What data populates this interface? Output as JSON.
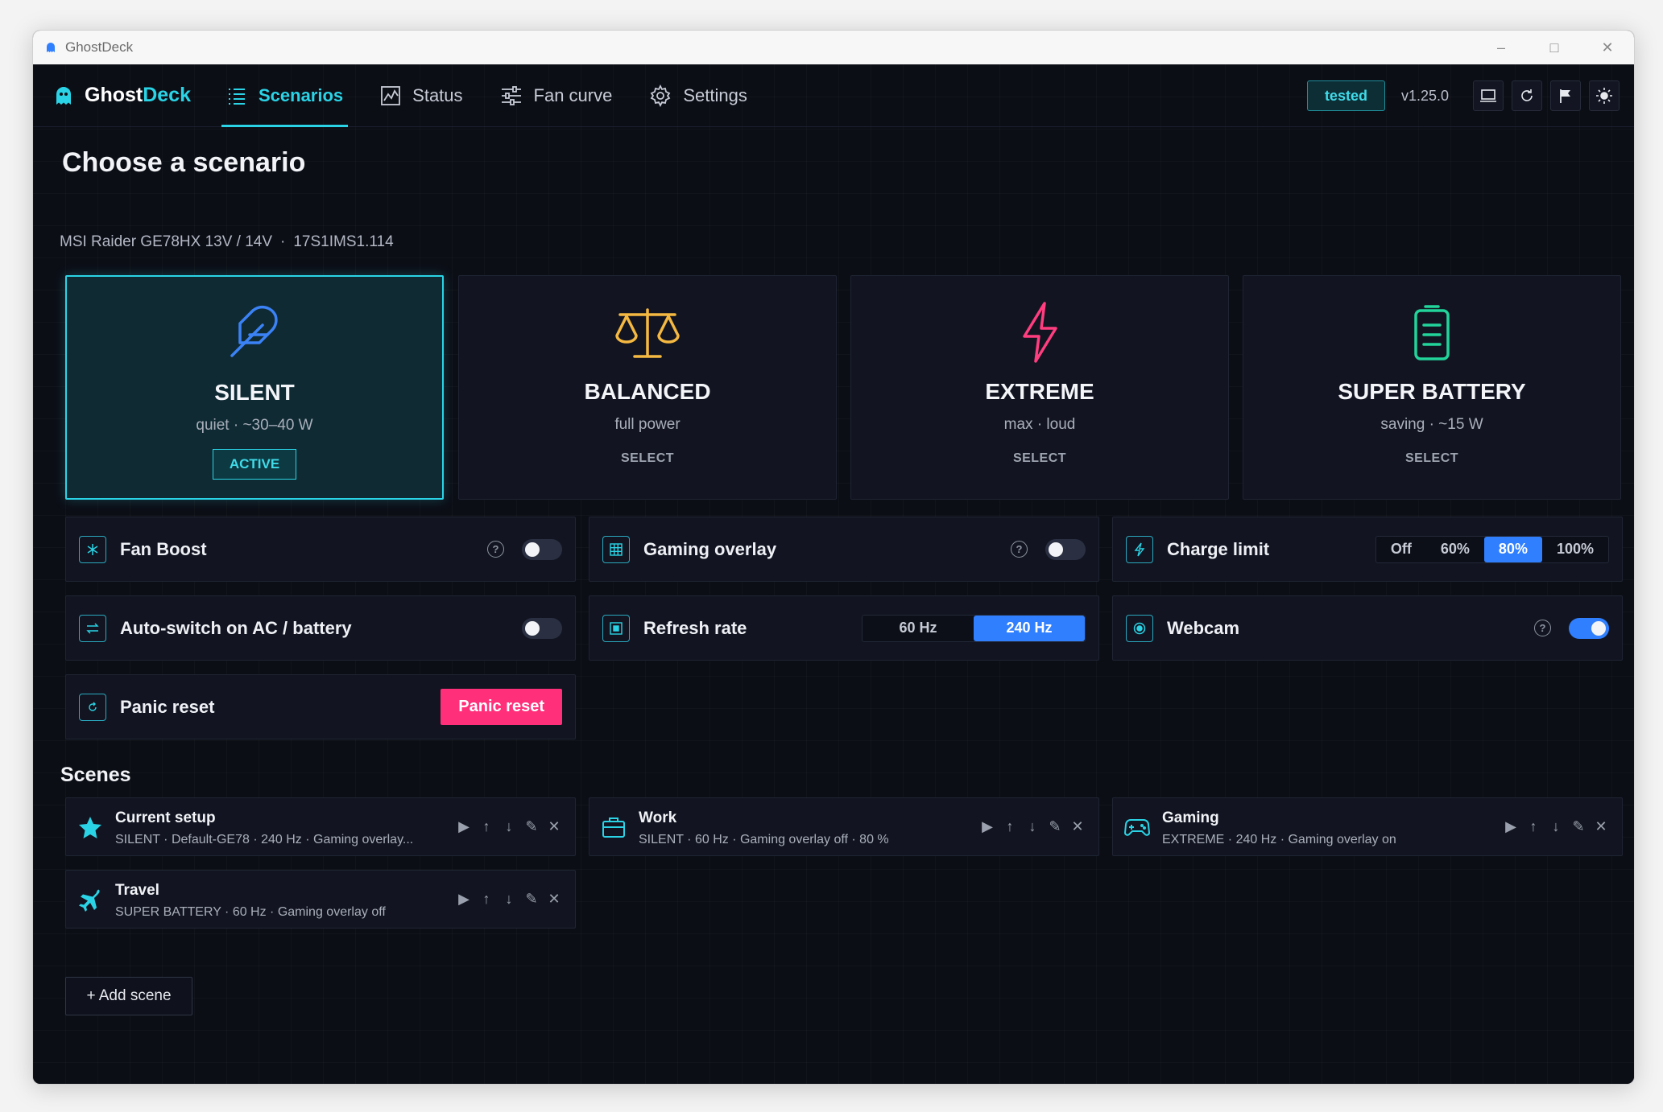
{
  "window": {
    "title": "GhostDeck",
    "controls": [
      "–",
      "□",
      "✕"
    ]
  },
  "brand": {
    "part1": "Ghost",
    "part2": "Deck"
  },
  "nav": {
    "tabs": [
      {
        "label": "Scenarios",
        "icon": "list-icon",
        "active": true
      },
      {
        "label": "Status",
        "icon": "chart-icon",
        "active": false
      },
      {
        "label": "Fan curve",
        "icon": "sliders-icon",
        "active": false
      },
      {
        "label": "Settings",
        "icon": "gear-icon",
        "active": false
      }
    ],
    "badge": "tested",
    "version": "v1.25.0",
    "icons": [
      "laptop-icon",
      "refresh-icon",
      "flag-icon",
      "sun-icon"
    ]
  },
  "page": {
    "title": "Choose a scenario",
    "device": "MSI Raider GE78HX 13V / 14V",
    "bios": "17S1IMS1.114",
    "separator": "·"
  },
  "scenarios": [
    {
      "name": "SILENT",
      "desc": "quiet · ~30–40 W",
      "action": "ACTIVE",
      "active": true,
      "icon": "feather-icon",
      "color": "#3b82f6"
    },
    {
      "name": "BALANCED",
      "desc": "full power",
      "action": "SELECT",
      "active": false,
      "icon": "scale-icon",
      "color": "#f5b942"
    },
    {
      "name": "EXTREME",
      "desc": "max · loud",
      "action": "SELECT",
      "active": false,
      "icon": "bolt-icon",
      "color": "#ff3d7f"
    },
    {
      "name": "SUPER BATTERY",
      "desc": "saving · ~15 W",
      "action": "SELECT",
      "active": false,
      "icon": "battery-icon",
      "color": "#22d39a"
    }
  ],
  "cards": {
    "fan_boost": {
      "label": "Fan Boost",
      "help": "?",
      "enabled": false
    },
    "gaming_overlay": {
      "label": "Gaming overlay",
      "help": "?",
      "enabled": false
    },
    "charge_limit": {
      "label": "Charge limit",
      "options": [
        "Off",
        "60%",
        "80%",
        "100%"
      ],
      "selected": "80%"
    },
    "auto_switch": {
      "label": "Auto-switch on AC / battery",
      "enabled": false
    },
    "refresh_rate": {
      "label": "Refresh rate",
      "options": [
        "60 Hz",
        "240 Hz"
      ],
      "selected": "240 Hz"
    },
    "webcam": {
      "label": "Webcam",
      "help": "?",
      "enabled": true
    },
    "panic_reset": {
      "label": "Panic reset",
      "button": "Panic reset"
    }
  },
  "scenes": {
    "title": "Scenes",
    "items": [
      {
        "name": "Current setup",
        "meta": "SILENT  ·  Default-GE78  ·  240 Hz  ·  Gaming overlay...",
        "icon": "star-icon"
      },
      {
        "name": "Work",
        "meta": "SILENT  ·  60 Hz  ·  Gaming overlay off  ·  80 %",
        "icon": "briefcase-icon"
      },
      {
        "name": "Gaming",
        "meta": "EXTREME  ·  240 Hz  ·  Gaming overlay on",
        "icon": "gamepad-icon"
      },
      {
        "name": "Travel",
        "meta": "SUPER BATTERY  ·  60 Hz  ·  Gaming overlay off",
        "icon": "plane-icon"
      }
    ],
    "actions": [
      "▶",
      "↑",
      "↓",
      "✎",
      "✕"
    ],
    "add_label": "+  Add scene"
  },
  "colors": {
    "accent": "#2ad4e6",
    "blue": "#2f7fff",
    "pink": "#ff2f7a"
  }
}
